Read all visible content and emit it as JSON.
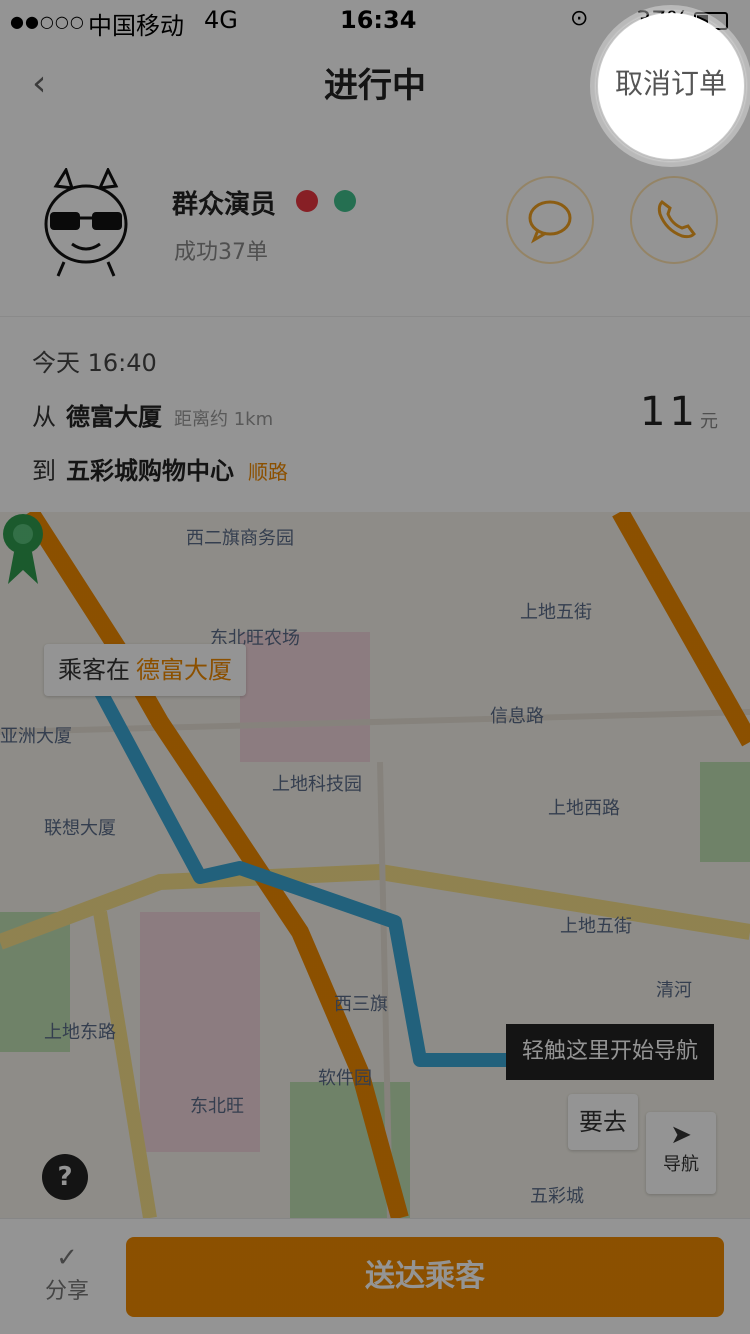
{
  "status_bar": {
    "signal": "●●○○○",
    "carrier": "中国移动",
    "network": "4G",
    "time": "16:34",
    "battery": "37%",
    "battery_level": 0.37
  },
  "nav": {
    "title": "进行中",
    "cancel_label": "取消订单"
  },
  "driver": {
    "name": "群众演员",
    "subtitle": "成功37单"
  },
  "trip": {
    "time": "今天 16:40",
    "from_label": "从",
    "from_place": "德富大厦",
    "from_distance": "距离约 1km",
    "to_label": "到",
    "to_place": "五彩城购物中心",
    "to_tag": "顺路",
    "fare": "11",
    "fare_unit": "元"
  },
  "map": {
    "pickup_prefix": "乘客在",
    "pickup_place": "德富大厦",
    "nav_tip": "轻触这里开始导航",
    "go_label": "要去",
    "navigate_label": "导航",
    "help_label": "?",
    "labels": {
      "l1": "西二旗商务园",
      "l2": "上地五街",
      "l3": "东北旺农场",
      "l4": "亚洲大厦",
      "l5": "信息路",
      "l6": "上地科技园",
      "l7": "联想大厦",
      "l8": "上地西路",
      "l9": "上地五街",
      "l10": "上地东路",
      "l11": "软件园",
      "l12": "东北旺",
      "l13": "清河",
      "l14": "西三旗",
      "l15": "五彩城"
    }
  },
  "bottom": {
    "share_label": "分享",
    "primary_label": "送达乘客"
  }
}
